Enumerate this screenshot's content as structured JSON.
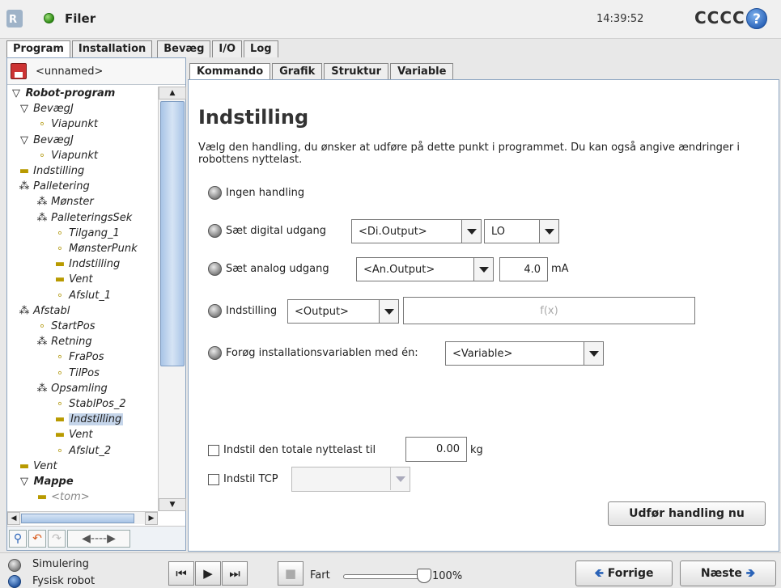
{
  "topbar": {
    "title": "Filer",
    "clock": "14:39:52",
    "robot_name": "CCCC",
    "help_glyph": "?"
  },
  "main_tabs": [
    {
      "label": "Program",
      "active": true
    },
    {
      "label": "Installation",
      "active": false
    },
    {
      "label": "Bevæg",
      "active": false
    },
    {
      "label": "I/O",
      "active": false
    },
    {
      "label": "Log",
      "active": false
    }
  ],
  "program": {
    "name": "<unnamed>",
    "tree": [
      {
        "label": "Robot-program",
        "icon": "triangle-down",
        "bold": true
      },
      {
        "label": "BevægJ",
        "icon": "triangle-down"
      },
      {
        "label": "Viapunkt",
        "icon": "waypoint"
      },
      {
        "label": "BevægJ",
        "icon": "triangle-down"
      },
      {
        "label": "Viapunkt",
        "icon": "waypoint"
      },
      {
        "label": "Indstilling",
        "icon": "set-bar"
      },
      {
        "label": "Palletering",
        "icon": "dots"
      },
      {
        "label": "Mønster",
        "icon": "dots"
      },
      {
        "label": "PalleteringsSek",
        "icon": "dots"
      },
      {
        "label": "Tilgang_1",
        "icon": "waypoint"
      },
      {
        "label": "MønsterPunk",
        "icon": "waypoint"
      },
      {
        "label": "Indstilling",
        "icon": "set-bar"
      },
      {
        "label": "Vent",
        "icon": "set-bar"
      },
      {
        "label": "Afslut_1",
        "icon": "waypoint"
      },
      {
        "label": "Afstabl",
        "icon": "dots"
      },
      {
        "label": "StartPos",
        "icon": "waypoint"
      },
      {
        "label": "Retning",
        "icon": "dots"
      },
      {
        "label": "FraPos",
        "icon": "waypoint"
      },
      {
        "label": "TilPos",
        "icon": "waypoint"
      },
      {
        "label": "Opsamling",
        "icon": "dots"
      },
      {
        "label": "StablPos_2",
        "icon": "waypoint"
      },
      {
        "label": "Indstilling",
        "icon": "set-bar",
        "selected": true
      },
      {
        "label": "Vent",
        "icon": "set-bar"
      },
      {
        "label": "Afslut_2",
        "icon": "waypoint"
      },
      {
        "label": "Vent",
        "icon": "set-bar"
      },
      {
        "label": "Mappe",
        "icon": "triangle-down",
        "bold": true
      },
      {
        "label": "<tom>",
        "icon": "set-bar",
        "muted": true
      }
    ]
  },
  "sub_tabs": [
    {
      "label": "Kommando",
      "active": true
    },
    {
      "label": "Grafik",
      "active": false
    },
    {
      "label": "Struktur",
      "active": false
    },
    {
      "label": "Variable",
      "active": false
    }
  ],
  "command": {
    "heading": "Indstilling",
    "description": "Vælg den handling, du ønsker at udføre på dette punkt i programmet. Du kan også angive ændringer i robottens nyttelast.",
    "opt_none": "Ingen handling",
    "opt_digital": "Sæt digital udgang",
    "digital_output": "<Di.Output>",
    "digital_value": "LO",
    "opt_analog": "Sæt analog udgang",
    "analog_output": "<An.Output>",
    "analog_value": "4.0",
    "analog_unit": "mA",
    "opt_expression": "Indstilling",
    "expression_output": "<Output>",
    "expression_placeholder": "f(x)",
    "opt_increment": "Forøg installationsvariablen med én:",
    "increment_variable": "<Variable>",
    "payload_label": "Indstil den totale nyttelast til",
    "payload_value": "0.00",
    "payload_unit": "kg",
    "tcp_label": "Indstil TCP",
    "run_button": "Udfør handling nu"
  },
  "bottombar": {
    "mode_simulation": "Simulering",
    "mode_physical": "Fysisk robot",
    "speed_label": "Fart",
    "speed_value": "100%",
    "speed_fraction": 1.0,
    "prev_button": "Forrige",
    "next_button": "Næste"
  }
}
